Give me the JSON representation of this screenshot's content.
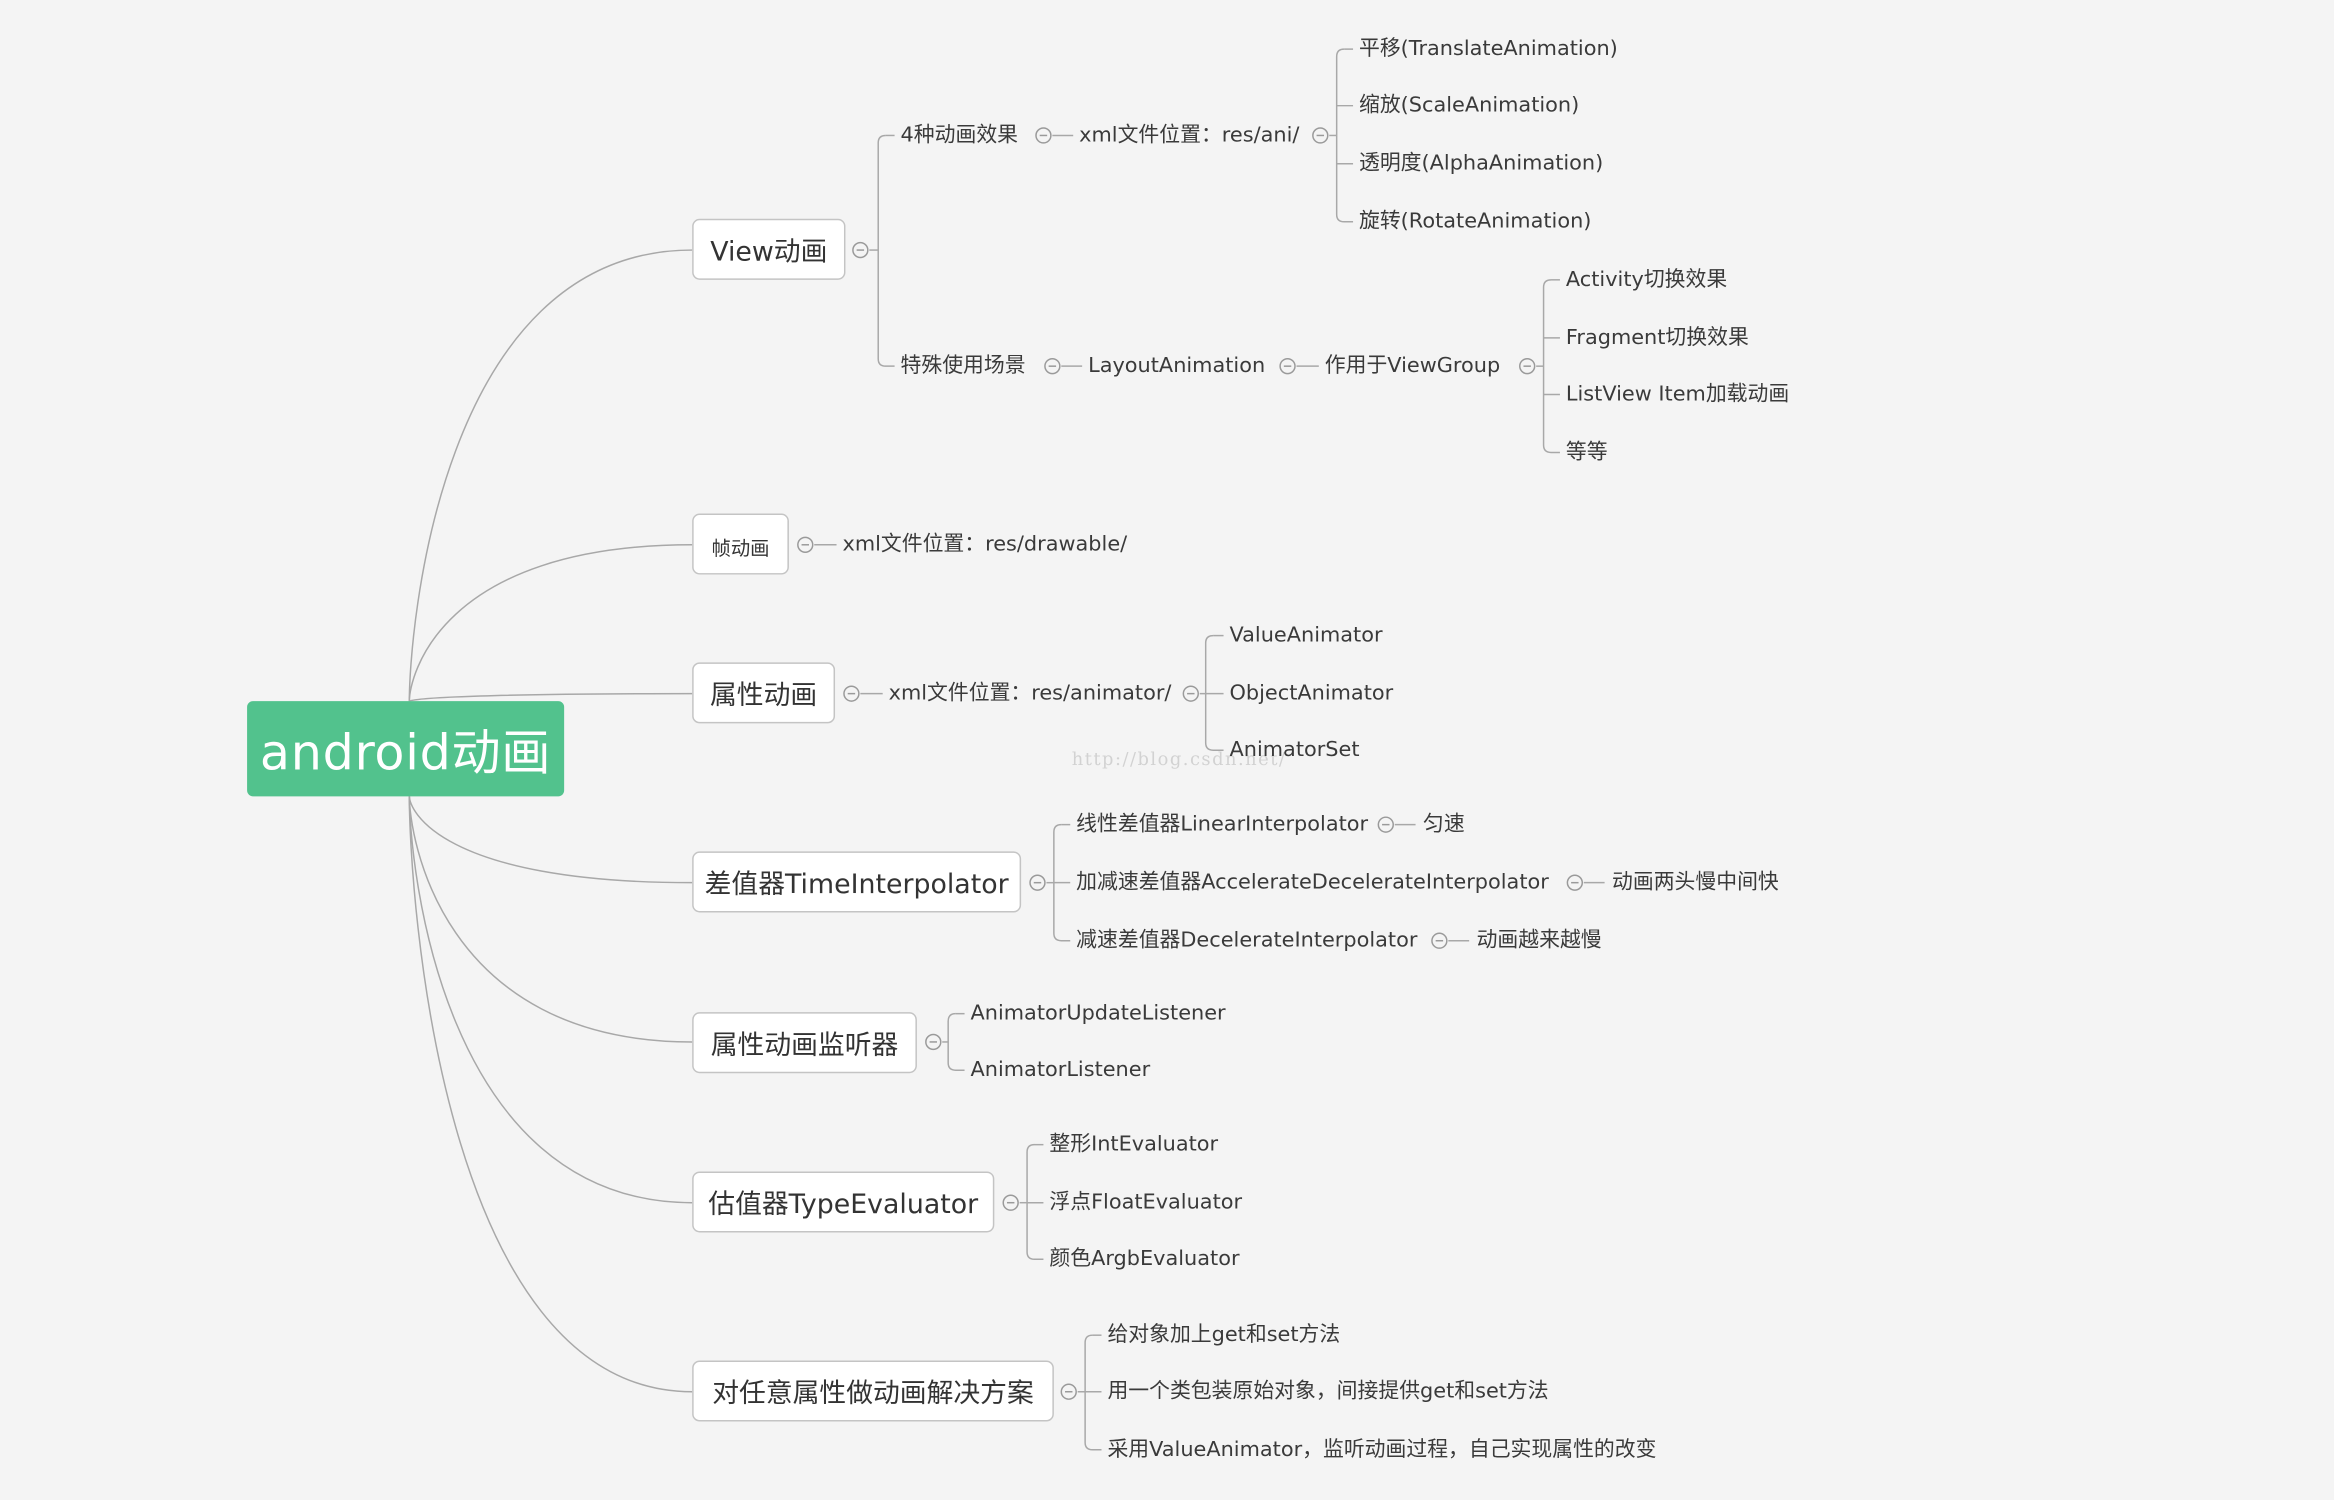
{
  "root": {
    "label": "android动画",
    "color": "#52c28d"
  },
  "watermark": "http://blog.csdn.net/",
  "branches": {
    "view": {
      "label": "View动画",
      "effects": {
        "label": "4种动画效果",
        "location": "xml文件位置：res/ani/",
        "items": [
          "平移(TranslateAnimation)",
          "缩放(ScaleAnimation)",
          "透明度(AlphaAnimation)",
          "旋转(RotateAnimation)"
        ]
      },
      "special": {
        "label": "特殊使用场景",
        "layout": "LayoutAnimation",
        "target": "作用于ViewGroup",
        "items": [
          "Activity切换效果",
          "Fragment切换效果",
          "ListView Item加载动画",
          "等等"
        ]
      }
    },
    "frame": {
      "label": "帧动画",
      "location": "xml文件位置：res/drawable/"
    },
    "property": {
      "label": "属性动画",
      "location": "xml文件位置：res/animator/",
      "items": [
        "ValueAnimator",
        "ObjectAnimator",
        "AnimatorSet"
      ]
    },
    "interpolator": {
      "label": "差值器TimeInterpolator",
      "items": [
        {
          "name": "线性差值器LinearInterpolator",
          "desc": "匀速"
        },
        {
          "name": "加减速差值器AccelerateDecelerateInterpolator",
          "desc": "动画两头慢中间快"
        },
        {
          "name": "减速差值器DecelerateInterpolator",
          "desc": "动画越来越慢"
        }
      ]
    },
    "listener": {
      "label": "属性动画监听器",
      "items": [
        "AnimatorUpdateListener",
        "AnimatorListener"
      ]
    },
    "evaluator": {
      "label": "估值器TypeEvaluator",
      "items": [
        "整形IntEvaluator",
        "浮点FloatEvaluator",
        "颜色ArgbEvaluator"
      ]
    },
    "solution": {
      "label": "对任意属性做动画解决方案",
      "items": [
        "给对象加上get和set方法",
        "用一个类包装原始对象，间接提供get和set方法",
        "采用ValueAnimator，监听动画过程，自己实现属性的改变"
      ]
    }
  }
}
